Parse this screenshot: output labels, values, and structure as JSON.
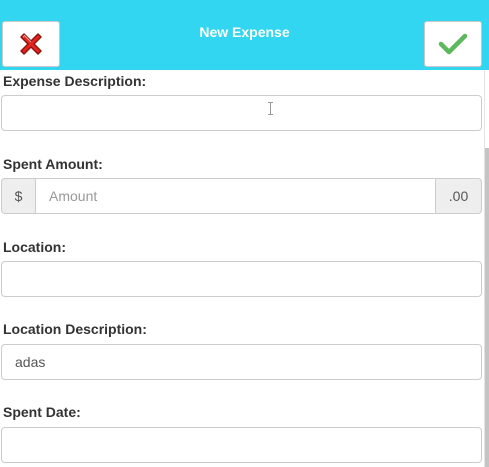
{
  "header": {
    "title": "New Expense",
    "background_color": "#33d6f1",
    "cancel_icon": "red-x-icon",
    "confirm_icon": "green-check-icon"
  },
  "form": {
    "description": {
      "label": "Expense Description:",
      "value": "",
      "placeholder": ""
    },
    "amount": {
      "label": "Spent Amount:",
      "prefix": "$",
      "placeholder": "Amount",
      "value": "",
      "suffix": ".00"
    },
    "location": {
      "label": "Location:",
      "value": "",
      "placeholder": ""
    },
    "location_description": {
      "label": "Location Description:",
      "value": "adas",
      "placeholder": ""
    },
    "spent_date": {
      "label": "Spent Date:",
      "value": "",
      "placeholder": ""
    }
  },
  "colors": {
    "cancel_red": "#e8231d",
    "confirm_green": "#5cb85c",
    "label_text": "#333333",
    "input_border": "#cccccc",
    "addon_bg": "#eeeeee"
  }
}
